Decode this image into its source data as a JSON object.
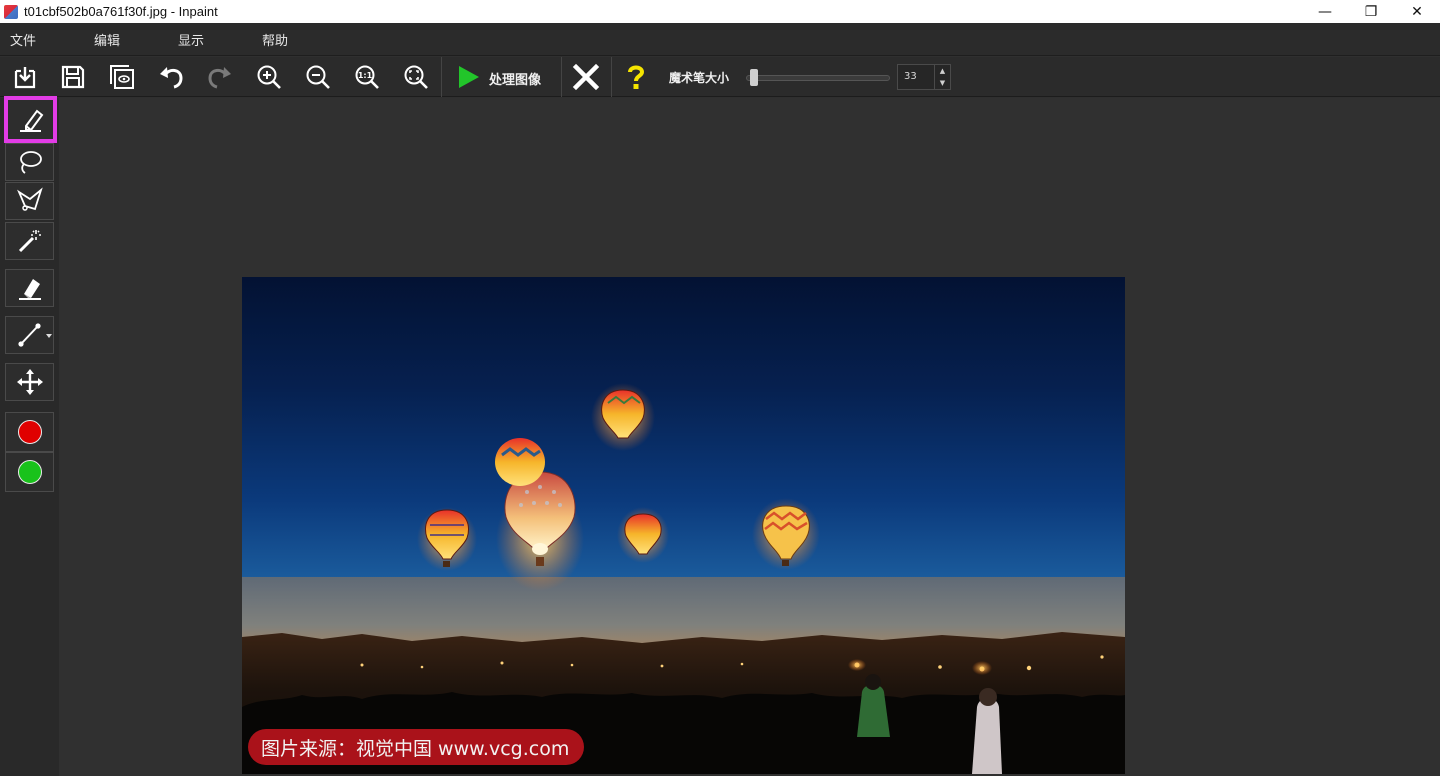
{
  "window": {
    "title": "t01cbf502b0a761f30f.jpg - Inpaint",
    "minimize": "—",
    "maximize": "❐",
    "close": "✕"
  },
  "menu": [
    "文件",
    "编辑",
    "显示",
    "帮助"
  ],
  "toolbar": {
    "process_label": "处理图像",
    "magic_wand_label": "魔术笔大小",
    "magic_wand_size": "33",
    "spin_up": "▲",
    "spin_down": "▼"
  },
  "tools": {
    "active": "marker",
    "colors": {
      "red": "#e00000",
      "green": "#19c21b"
    }
  },
  "photo": {
    "watermark": "图片来源：视觉中国 www.vcg.com"
  },
  "accent": {
    "highlight": "#e23ce6",
    "play": "#22c52a",
    "help": "#f5e400"
  }
}
